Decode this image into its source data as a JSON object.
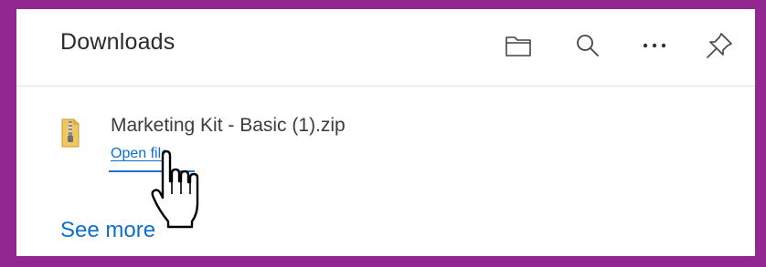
{
  "panel": {
    "title": "Downloads",
    "toolbar": [
      {
        "name": "open-folder-button",
        "icon": "folder-icon"
      },
      {
        "name": "search-button",
        "icon": "search-icon"
      },
      {
        "name": "more-options-button",
        "icon": "more-icon"
      },
      {
        "name": "pin-button",
        "icon": "pin-icon"
      }
    ]
  },
  "download": {
    "file_name": "Marketing Kit - Basic (1).zip",
    "file_icon": "zip-file-icon",
    "action_label": "Open file"
  },
  "footer": {
    "see_more_label": "See more"
  },
  "colors": {
    "frame": "#92278f",
    "link": "#0a6fd1",
    "text": "#2b2b2b"
  },
  "cursor": "hand-pointer-icon"
}
